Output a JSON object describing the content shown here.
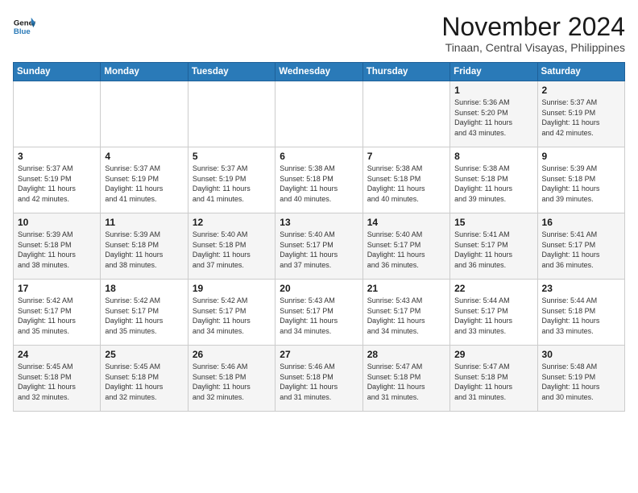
{
  "header": {
    "logo_line1": "General",
    "logo_line2": "Blue",
    "month": "November 2024",
    "location": "Tinaan, Central Visayas, Philippines"
  },
  "weekdays": [
    "Sunday",
    "Monday",
    "Tuesday",
    "Wednesday",
    "Thursday",
    "Friday",
    "Saturday"
  ],
  "weeks": [
    [
      {
        "day": "",
        "info": ""
      },
      {
        "day": "",
        "info": ""
      },
      {
        "day": "",
        "info": ""
      },
      {
        "day": "",
        "info": ""
      },
      {
        "day": "",
        "info": ""
      },
      {
        "day": "1",
        "info": "Sunrise: 5:36 AM\nSunset: 5:20 PM\nDaylight: 11 hours\nand 43 minutes."
      },
      {
        "day": "2",
        "info": "Sunrise: 5:37 AM\nSunset: 5:19 PM\nDaylight: 11 hours\nand 42 minutes."
      }
    ],
    [
      {
        "day": "3",
        "info": "Sunrise: 5:37 AM\nSunset: 5:19 PM\nDaylight: 11 hours\nand 42 minutes."
      },
      {
        "day": "4",
        "info": "Sunrise: 5:37 AM\nSunset: 5:19 PM\nDaylight: 11 hours\nand 41 minutes."
      },
      {
        "day": "5",
        "info": "Sunrise: 5:37 AM\nSunset: 5:19 PM\nDaylight: 11 hours\nand 41 minutes."
      },
      {
        "day": "6",
        "info": "Sunrise: 5:38 AM\nSunset: 5:18 PM\nDaylight: 11 hours\nand 40 minutes."
      },
      {
        "day": "7",
        "info": "Sunrise: 5:38 AM\nSunset: 5:18 PM\nDaylight: 11 hours\nand 40 minutes."
      },
      {
        "day": "8",
        "info": "Sunrise: 5:38 AM\nSunset: 5:18 PM\nDaylight: 11 hours\nand 39 minutes."
      },
      {
        "day": "9",
        "info": "Sunrise: 5:39 AM\nSunset: 5:18 PM\nDaylight: 11 hours\nand 39 minutes."
      }
    ],
    [
      {
        "day": "10",
        "info": "Sunrise: 5:39 AM\nSunset: 5:18 PM\nDaylight: 11 hours\nand 38 minutes."
      },
      {
        "day": "11",
        "info": "Sunrise: 5:39 AM\nSunset: 5:18 PM\nDaylight: 11 hours\nand 38 minutes."
      },
      {
        "day": "12",
        "info": "Sunrise: 5:40 AM\nSunset: 5:18 PM\nDaylight: 11 hours\nand 37 minutes."
      },
      {
        "day": "13",
        "info": "Sunrise: 5:40 AM\nSunset: 5:17 PM\nDaylight: 11 hours\nand 37 minutes."
      },
      {
        "day": "14",
        "info": "Sunrise: 5:40 AM\nSunset: 5:17 PM\nDaylight: 11 hours\nand 36 minutes."
      },
      {
        "day": "15",
        "info": "Sunrise: 5:41 AM\nSunset: 5:17 PM\nDaylight: 11 hours\nand 36 minutes."
      },
      {
        "day": "16",
        "info": "Sunrise: 5:41 AM\nSunset: 5:17 PM\nDaylight: 11 hours\nand 36 minutes."
      }
    ],
    [
      {
        "day": "17",
        "info": "Sunrise: 5:42 AM\nSunset: 5:17 PM\nDaylight: 11 hours\nand 35 minutes."
      },
      {
        "day": "18",
        "info": "Sunrise: 5:42 AM\nSunset: 5:17 PM\nDaylight: 11 hours\nand 35 minutes."
      },
      {
        "day": "19",
        "info": "Sunrise: 5:42 AM\nSunset: 5:17 PM\nDaylight: 11 hours\nand 34 minutes."
      },
      {
        "day": "20",
        "info": "Sunrise: 5:43 AM\nSunset: 5:17 PM\nDaylight: 11 hours\nand 34 minutes."
      },
      {
        "day": "21",
        "info": "Sunrise: 5:43 AM\nSunset: 5:17 PM\nDaylight: 11 hours\nand 34 minutes."
      },
      {
        "day": "22",
        "info": "Sunrise: 5:44 AM\nSunset: 5:17 PM\nDaylight: 11 hours\nand 33 minutes."
      },
      {
        "day": "23",
        "info": "Sunrise: 5:44 AM\nSunset: 5:18 PM\nDaylight: 11 hours\nand 33 minutes."
      }
    ],
    [
      {
        "day": "24",
        "info": "Sunrise: 5:45 AM\nSunset: 5:18 PM\nDaylight: 11 hours\nand 32 minutes."
      },
      {
        "day": "25",
        "info": "Sunrise: 5:45 AM\nSunset: 5:18 PM\nDaylight: 11 hours\nand 32 minutes."
      },
      {
        "day": "26",
        "info": "Sunrise: 5:46 AM\nSunset: 5:18 PM\nDaylight: 11 hours\nand 32 minutes."
      },
      {
        "day": "27",
        "info": "Sunrise: 5:46 AM\nSunset: 5:18 PM\nDaylight: 11 hours\nand 31 minutes."
      },
      {
        "day": "28",
        "info": "Sunrise: 5:47 AM\nSunset: 5:18 PM\nDaylight: 11 hours\nand 31 minutes."
      },
      {
        "day": "29",
        "info": "Sunrise: 5:47 AM\nSunset: 5:18 PM\nDaylight: 11 hours\nand 31 minutes."
      },
      {
        "day": "30",
        "info": "Sunrise: 5:48 AM\nSunset: 5:19 PM\nDaylight: 11 hours\nand 30 minutes."
      }
    ]
  ]
}
